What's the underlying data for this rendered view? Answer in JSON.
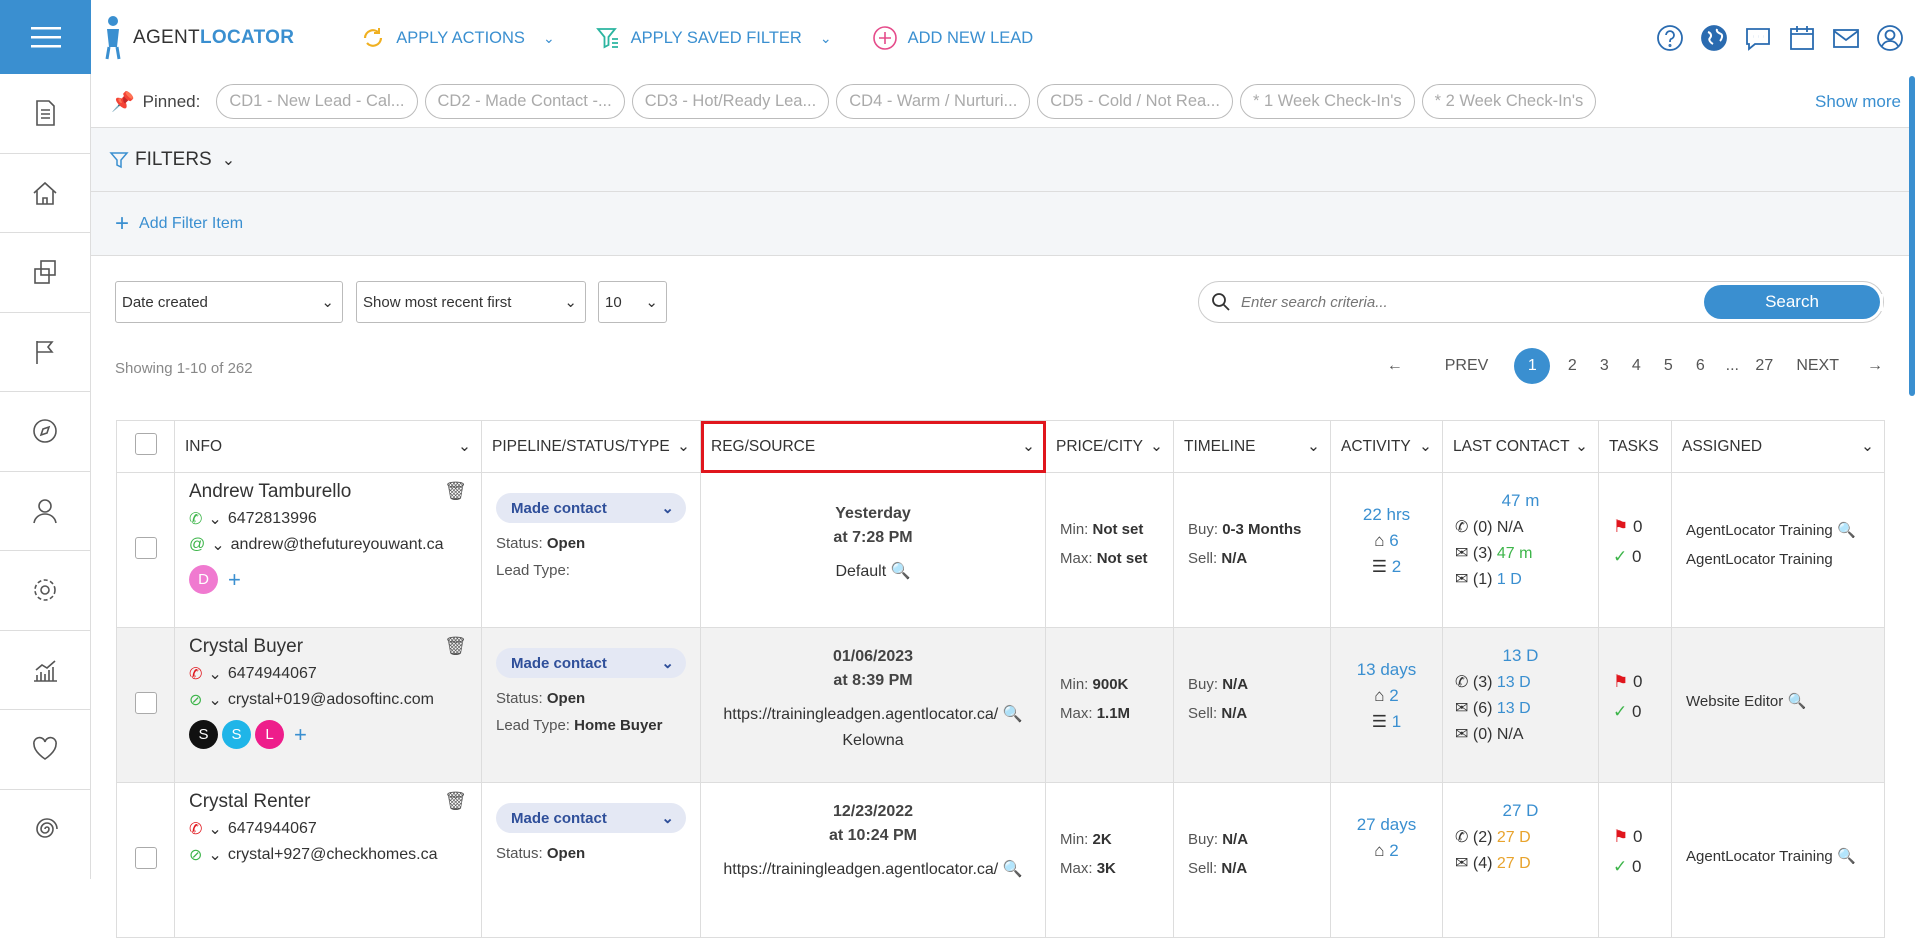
{
  "app": {
    "logo_a": "AGENT",
    "logo_b": "LOCATOR"
  },
  "toolbar": {
    "apply_actions": "APPLY ACTIONS",
    "apply_saved_filter": "APPLY SAVED FILTER",
    "add_new_lead": "ADD NEW LEAD"
  },
  "pinned": {
    "label": "Pinned:",
    "items": [
      "CD1 - New Lead - Cal...",
      "CD2 - Made Contact -...",
      "CD3 - Hot/Ready Lea...",
      "CD4 - Warm / Nurturi...",
      "CD5 - Cold / Not Rea...",
      "* 1 Week Check-In's",
      "* 2 Week Check-In's"
    ],
    "show_more": "Show more"
  },
  "filters": {
    "label": "FILTERS",
    "add_item": "Add Filter Item"
  },
  "controls": {
    "sort_field": "Date created",
    "sort_order": "Show most recent first",
    "page_size": "10",
    "search_placeholder": "Enter search criteria...",
    "search_button": "Search"
  },
  "showing": "Showing 1-10 of 262",
  "pager": {
    "prev": "PREV",
    "pages": [
      "1",
      "2",
      "3",
      "4",
      "5",
      "6",
      "...",
      "27"
    ],
    "next": "NEXT"
  },
  "columns": [
    "INFO",
    "PIPELINE/STATUS/TYPE",
    "REG/SOURCE",
    "PRICE/CITY",
    "TIMELINE",
    "ACTIVITY",
    "LAST CONTACT",
    "TASKS",
    "ASSIGNED"
  ],
  "rows": [
    {
      "name": "Andrew Tamburello",
      "phone": "6472813996",
      "email": "andrew@thefutureyouwant.ca",
      "tags": [
        "D"
      ],
      "pipeline": "Made contact",
      "status_label": "Status:",
      "status": "Open",
      "lead_type_label": "Lead Type:",
      "lead_type": "",
      "reg_line1": "Yesterday",
      "reg_line2": "at 7:28 PM",
      "source": "Default",
      "source2": "",
      "min_label": "Min:",
      "min": "Not set",
      "max_label": "Max:",
      "max": "Not set",
      "buy_label": "Buy:",
      "buy": "0-3 Months",
      "sell_label": "Sell:",
      "sell": "N/A",
      "activity": "22 hrs",
      "houses": "6",
      "db": "2",
      "last_contact": "47 m",
      "calls": "(0) N/A",
      "emails_count": "(3)",
      "emails_time": "47 m",
      "texts_count": "(1)",
      "texts_time": "1 D",
      "flags": "0",
      "checks": "0",
      "assigned1": "AgentLocator Training",
      "assigned2": "AgentLocator Training"
    },
    {
      "name": "Crystal Buyer",
      "phone": "6474944067",
      "email": "crystal+019@adosoftinc.com",
      "tags": [
        "S",
        "S",
        "L"
      ],
      "pipeline": "Made contact",
      "status_label": "Status:",
      "status": "Open",
      "lead_type_label": "Lead Type:",
      "lead_type": "Home Buyer",
      "reg_line1": "01/06/2023",
      "reg_line2": "at 8:39 PM",
      "source": "https://trainingleadgen.agentlocator.ca/",
      "source2": "Kelowna",
      "min_label": "Min:",
      "min": "900K",
      "max_label": "Max:",
      "max": "1.1M",
      "buy_label": "Buy:",
      "buy": "N/A",
      "sell_label": "Sell:",
      "sell": "N/A",
      "activity": "13 days",
      "houses": "2",
      "db": "1",
      "last_contact": "13 D",
      "calls_count": "(3)",
      "calls_time": "13 D",
      "emails_count": "(6)",
      "emails_time": "13 D",
      "texts": "(0) N/A",
      "flags": "0",
      "checks": "0",
      "assigned1": "Website Editor"
    },
    {
      "name": "Crystal Renter",
      "phone": "6474944067",
      "email": "crystal+927@checkhomes.ca",
      "pipeline": "Made contact",
      "status_label": "Status:",
      "status": "Open",
      "reg_line1": "12/23/2022",
      "reg_line2": "at 10:24 PM",
      "source": "https://trainingleadgen.agentlocator.ca/",
      "min_label": "Min:",
      "min": "2K",
      "max_label": "Max:",
      "max": "3K",
      "buy_label": "Buy:",
      "buy": "N/A",
      "sell_label": "Sell:",
      "sell": "N/A",
      "activity": "27 days",
      "houses": "2",
      "last_contact": "27 D",
      "calls_count": "(2)",
      "calls_time": "27 D",
      "emails_count": "(4)",
      "emails_time": "27 D",
      "flags": "0",
      "checks": "0",
      "assigned1": "AgentLocator Training"
    }
  ],
  "colors": {
    "accent": "#3a8fd0",
    "highlight": "#e0161d",
    "tag_d": "#f07ad0",
    "tag_s1": "#111111",
    "tag_s2": "#1fb5e8",
    "tag_l": "#ee1d8b"
  }
}
